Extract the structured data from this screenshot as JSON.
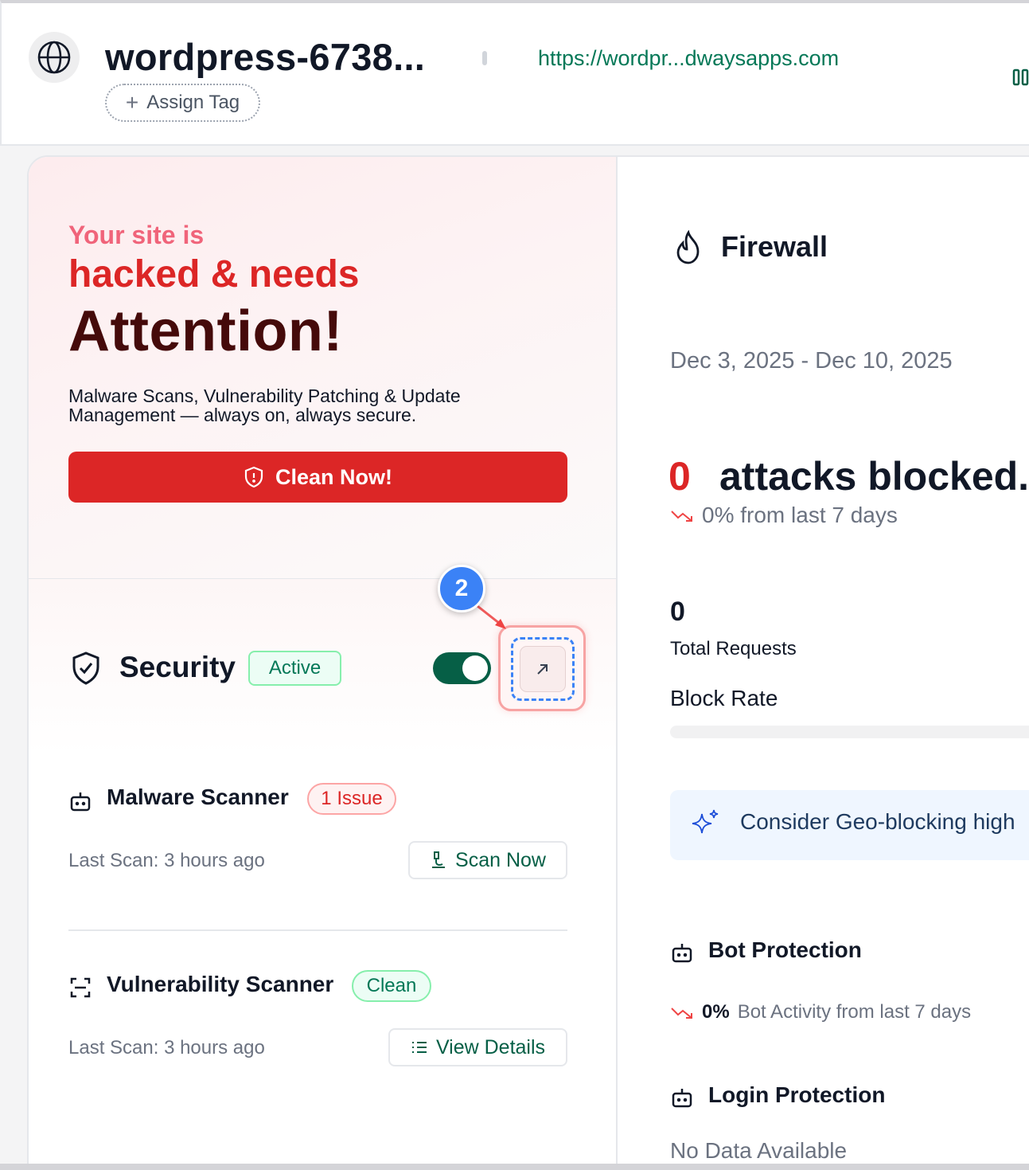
{
  "header": {
    "site_title": "wordpress-6738...",
    "site_url": "https://wordpr...dwaysapps.com",
    "assign_tag_label": "Assign Tag"
  },
  "hero": {
    "line1": "Your site is",
    "line2": "hacked & needs",
    "line3": "Attention!",
    "description": "Malware Scans, Vulnerability Patching & Update Management — always on, always secure.",
    "clean_button_label": "Clean Now!"
  },
  "security": {
    "title": "Security",
    "status_badge": "Active",
    "toggle_on": true,
    "step_number": "2"
  },
  "scanners": [
    {
      "title": "Malware Scanner",
      "badge": "1 Issue",
      "last_scan": "Last Scan: 3 hours ago",
      "action_label": "Scan Now"
    },
    {
      "title": "Vulnerability Scanner",
      "badge": "Clean",
      "last_scan": "Last Scan: 3 hours ago",
      "action_label": "View Details"
    }
  ],
  "firewall": {
    "title": "Firewall",
    "date_range": "Dec 3, 2025 - Dec 10, 2025",
    "attacks_count": "0",
    "attacks_label": "attacks blocked.",
    "attacks_trend": "0% from last 7 days",
    "total_requests": "0",
    "total_requests_label": "Total Requests",
    "block_rate_label": "Block Rate",
    "block_rate_fraction": 0,
    "geo_tip": "Consider Geo-blocking high",
    "bot_title": "Bot Protection",
    "bot_percent": "0%",
    "bot_trend_text": "Bot Activity from last 7 days",
    "login_title": "Login Protection",
    "login_status": "No Data Available"
  },
  "colors": {
    "danger": "#dc2626",
    "success": "#047857",
    "accent_blue": "#3b82f6"
  },
  "icons": {
    "globe": "globe-icon",
    "plus": "plus-icon",
    "shield_alert": "shield-alert-icon",
    "shield_check": "shield-check-icon",
    "external_link": "arrow-up-right-icon",
    "robot": "robot-icon",
    "scan_frame": "scan-frame-icon",
    "microscope": "microscope-icon",
    "list": "list-icon",
    "flame": "flame-icon",
    "trend_down": "trend-down-icon",
    "sparkles": "sparkles-icon"
  }
}
